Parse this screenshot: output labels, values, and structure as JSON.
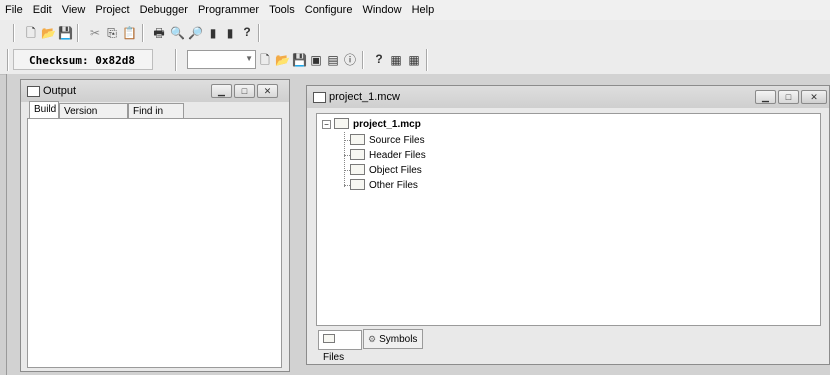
{
  "menu": [
    "File",
    "Edit",
    "View",
    "Project",
    "Debugger",
    "Programmer",
    "Tools",
    "Configure",
    "Window",
    "Help"
  ],
  "toolbar1_icons": [
    "new-file-icon",
    "open-folder-icon",
    "save-icon",
    "cut-icon",
    "copy-icon",
    "paste-icon",
    "print-icon",
    "find-icon",
    "find-in-files-icon",
    "bookmark-icon",
    "bookmark-next-icon",
    "help-icon"
  ],
  "toolbar2": {
    "checksum": "Checksum:  0x82d8",
    "icons": [
      "new-project-icon",
      "open-project-icon",
      "save-project-icon",
      "project-build-icon",
      "project-properties-icon",
      "info-icon",
      "help-icon",
      "build-all-icon",
      "make-icon"
    ]
  },
  "output": {
    "title": "Output",
    "tabs": [
      "Build",
      "Version Control",
      "Find in Files"
    ]
  },
  "project": {
    "title": "project_1.mcw",
    "root": "project_1.mcp",
    "folders": [
      "Source Files",
      "Header Files",
      "Object Files",
      "Other Files"
    ],
    "bottom_tabs": [
      "Files",
      "Symbols"
    ]
  }
}
